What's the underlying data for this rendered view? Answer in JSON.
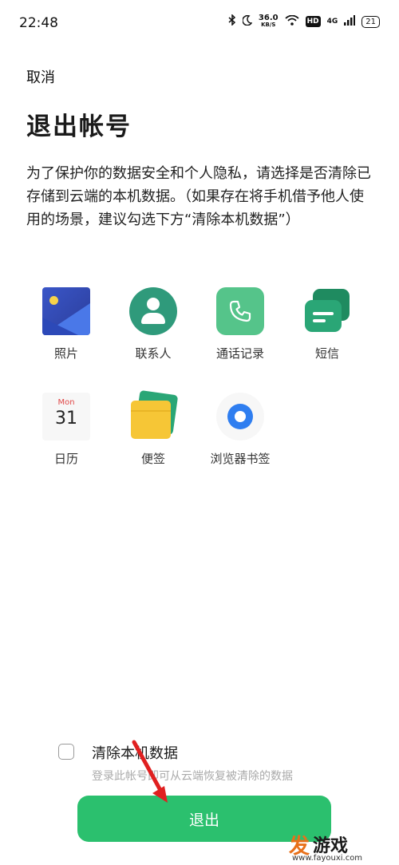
{
  "status_bar": {
    "time": "22:48",
    "net_speed": "36.0",
    "net_speed_unit": "KB/S",
    "hd": "HD",
    "network": "4G",
    "battery": "21",
    "icons": [
      "bluetooth-icon",
      "moon-icon",
      "wifi-icon",
      "signal-icon"
    ]
  },
  "header": {
    "cancel_label": "取消",
    "title": "退出帐号"
  },
  "description": "为了保护你的数据安全和个人隐私，请选择是否清除已存储到云端的本机数据。（如果存在将手机借予他人使用的场景，建议勾选下方“清除本机数据”）",
  "apps": [
    {
      "label": "照片",
      "icon": "photos-icon"
    },
    {
      "label": "联系人",
      "icon": "contacts-icon"
    },
    {
      "label": "通话记录",
      "icon": "phone-icon"
    },
    {
      "label": "短信",
      "icon": "messages-icon"
    },
    {
      "label": "日历",
      "icon": "calendar-icon",
      "icon_text_month": "Mon",
      "icon_text_day": "31"
    },
    {
      "label": "便签",
      "icon": "notes-icon"
    },
    {
      "label": "浏览器书签",
      "icon": "browser-icon"
    }
  ],
  "clear_option": {
    "label": "清除本机数据",
    "hint": "登录此帐号即可从云端恢复被清除的数据",
    "checked": false
  },
  "logout_button": {
    "label": "退出",
    "color": "#2bc06e"
  },
  "watermark": {
    "mark": "发",
    "text": "游戏",
    "url": "www.fayouxi.com"
  }
}
